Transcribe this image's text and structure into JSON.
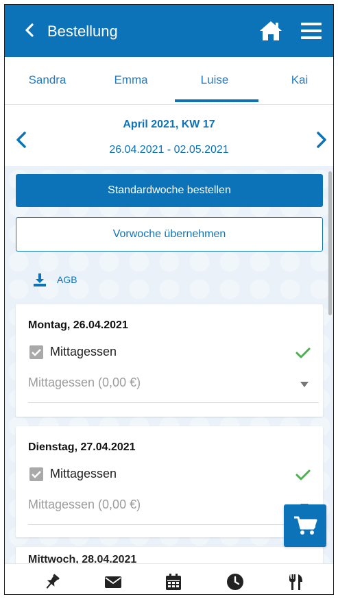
{
  "header": {
    "title": "Bestellung",
    "icons": {
      "back": "chevron-left-icon",
      "home": "home-icon",
      "menu": "hamburger-menu-icon"
    }
  },
  "tabs": [
    {
      "label": "Sandra"
    },
    {
      "label": "Emma"
    },
    {
      "label": "Luise",
      "active": true
    },
    {
      "label": "Kai"
    }
  ],
  "week": {
    "label": "April 2021, KW 17",
    "range": "26.04.2021 - 02.05.2021"
  },
  "actions": {
    "standard_week": "Standardwoche bestellen",
    "previous_week": "Vorwoche übernehmen",
    "agb": "AGB"
  },
  "days": [
    {
      "date": "Montag, 26.04.2021",
      "meal": "Mittagessen",
      "checked": true,
      "select_value": "Mittagessen (0,00 €)",
      "confirmed": true
    },
    {
      "date": "Dienstag, 27.04.2021",
      "meal": "Mittagessen",
      "checked": true,
      "select_value": "Mittagessen (0,00 €)",
      "confirmed": true
    },
    {
      "date": "Mittwoch, 28.04.2021"
    }
  ],
  "bottom_nav": [
    "pin-icon",
    "mail-icon",
    "calendar-icon",
    "clock-icon",
    "cutlery-icon"
  ],
  "colors": {
    "brand": "#0c73b9",
    "check": "#4caf50",
    "background": "#eaf1f8"
  }
}
